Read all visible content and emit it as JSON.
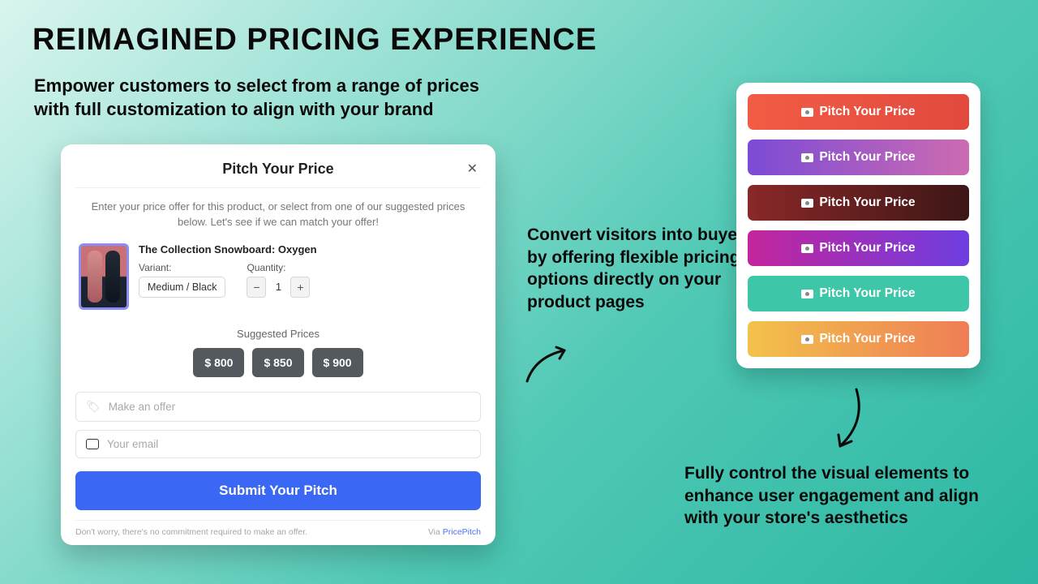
{
  "headline": "REIMAGINED PRICING EXPERIENCE",
  "subheadline": "Empower customers to select from a range of prices\nwith full customization to align with your brand",
  "modal": {
    "title": "Pitch Your Price",
    "close": "✕",
    "description": "Enter your price offer for this product, or select from one of our suggested prices below. Let's see if we can match your offer!",
    "product_name": "The Collection Snowboard: Oxygen",
    "variant_label": "Variant:",
    "variant_value": "Medium / Black",
    "quantity_label": "Quantity:",
    "quantity_value": "1",
    "suggested_label": "Suggested Prices",
    "suggested_prices": [
      "$ 800",
      "$ 850",
      "$ 900"
    ],
    "offer_placeholder": "Make an offer",
    "email_placeholder": "Your email",
    "submit_label": "Submit Your Pitch",
    "footnote": "Don't worry, there's no commitment required to make an offer.",
    "via_prefix": "Via ",
    "via_link": "PricePitch"
  },
  "mid_caption": "Convert visitors into buyers by offering flexible pricing options directly on your product pages",
  "lower_caption": "Fully control the visual elements to enhance user engagement and align with your store's aesthetics",
  "pitch_button_label": "Pitch Your Price"
}
